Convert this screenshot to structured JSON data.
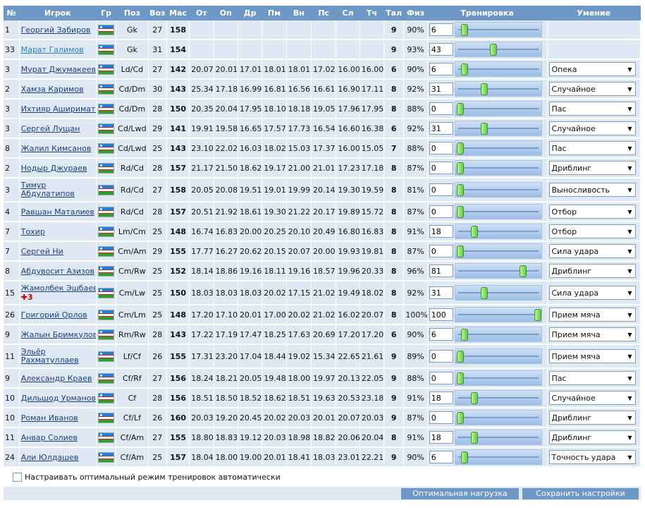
{
  "headers": {
    "num": "№",
    "player": "Игрок",
    "nation": "Гр",
    "pos": "Поз",
    "age": "Воз",
    "mastery": "Мас",
    "s1": "От",
    "s2": "Оп",
    "s3": "Др",
    "s4": "Пм",
    "s5": "Вн",
    "s6": "Пс",
    "s7": "Сл",
    "s8": "Тч",
    "talent": "Тал",
    "fitness": "Физ",
    "training": "Тренировка",
    "skill": "Умение"
  },
  "players": [
    {
      "num": "1",
      "name": "Георгий Забиров",
      "pos": "Gk",
      "age": "27",
      "mas": "158",
      "stats": [
        "",
        "",
        "",
        "",
        "",
        "",
        "",
        ""
      ],
      "tal": "9",
      "fiz": "90%",
      "train": "6",
      "skill": ""
    },
    {
      "num": "33",
      "name": "Марат Галимов",
      "pos": "Gk",
      "age": "31",
      "mas": "154",
      "stats": [
        "",
        "",
        "",
        "",
        "",
        "",
        "",
        ""
      ],
      "tal": "9",
      "fiz": "93%",
      "train": "43",
      "skill": ""
    },
    {
      "num": "3",
      "name": "Мурат Джумакеев",
      "pos": "Ld/Cd",
      "age": "27",
      "mas": "142",
      "stats": [
        "20.07",
        "20.01",
        "17.01",
        "18.01",
        "18.01",
        "17.02",
        "16.00",
        "16.00"
      ],
      "tal": "6",
      "fiz": "90%",
      "train": "6",
      "skill": "Опека"
    },
    {
      "num": "2",
      "name": "Хамза Каримов",
      "pos": "Cd/Dm",
      "age": "30",
      "mas": "143",
      "stats": [
        "25.34",
        "17.18",
        "16.99",
        "16.81",
        "16.56",
        "16.61",
        "16.90",
        "17.11"
      ],
      "tal": "8",
      "fiz": "92%",
      "train": "31",
      "skill": "Случайное"
    },
    {
      "num": "3",
      "name": "Ихтияр Ашириматов",
      "pos": "Cd/Dm",
      "age": "28",
      "mas": "150",
      "stats": [
        "20.35",
        "20.04",
        "17.95",
        "18.10",
        "18.18",
        "19.05",
        "17.96",
        "17.95"
      ],
      "tal": "8",
      "fiz": "88%",
      "train": "0",
      "skill": "Пас"
    },
    {
      "num": "3",
      "name": "Сергей Лущан",
      "pos": "Cd/Lwd",
      "age": "29",
      "mas": "141",
      "stats": [
        "19.91",
        "19.58",
        "16.65",
        "17.57",
        "17.73",
        "16.54",
        "16.60",
        "16.38"
      ],
      "tal": "6",
      "fiz": "92%",
      "train": "31",
      "skill": "Случайное"
    },
    {
      "num": "8",
      "name": "Жалил Кимсанов",
      "pos": "Cd/Lwd",
      "age": "25",
      "mas": "143",
      "stats": [
        "23.10",
        "22.02",
        "16.03",
        "18.02",
        "15.03",
        "17.37",
        "16.00",
        "15.05"
      ],
      "tal": "7",
      "fiz": "88%",
      "train": "0",
      "skill": "Пас"
    },
    {
      "num": "2",
      "name": "Нодыр Джураев",
      "pos": "Rd/Cd",
      "age": "28",
      "mas": "157",
      "stats": [
        "21.17",
        "21.50",
        "18.62",
        "19.17",
        "21.00",
        "21.01",
        "17.23",
        "17.18"
      ],
      "tal": "8",
      "fiz": "87%",
      "train": "0",
      "skill": "Дриблинг"
    },
    {
      "num": "3",
      "name": "Тимур Абдулатипов",
      "pos": "Rd/Cd",
      "age": "27",
      "mas": "158",
      "stats": [
        "20.05",
        "20.08",
        "19.51",
        "19.01",
        "19.99",
        "20.14",
        "19.30",
        "19.59"
      ],
      "tal": "8",
      "fiz": "81%",
      "train": "0",
      "skill": "Выносливость",
      "tall": true
    },
    {
      "num": "4",
      "name": "Равшан Маталиев",
      "pos": "Rd/Cd",
      "age": "28",
      "mas": "157",
      "stats": [
        "20.51",
        "21.92",
        "18.61",
        "19.30",
        "21.22",
        "20.17",
        "19.89",
        "15.72"
      ],
      "tal": "8",
      "fiz": "87%",
      "train": "0",
      "skill": "Отбор"
    },
    {
      "num": "7",
      "name": "Тохир",
      "pos": "Lm/Cm",
      "age": "25",
      "mas": "148",
      "stats": [
        "16.74",
        "16.83",
        "20.00",
        "20.25",
        "20.10",
        "20.49",
        "16.80",
        "16.83"
      ],
      "tal": "8",
      "fiz": "91%",
      "train": "18",
      "skill": "Отбор"
    },
    {
      "num": "7",
      "name": "Сергей Ни",
      "pos": "Cm/Am",
      "age": "29",
      "mas": "155",
      "stats": [
        "17.77",
        "16.27",
        "20.62",
        "20.15",
        "20.07",
        "20.00",
        "19.93",
        "19.81"
      ],
      "tal": "8",
      "fiz": "87%",
      "train": "0",
      "skill": "Сила удара"
    },
    {
      "num": "8",
      "name": "Абдувосит Азизов",
      "pos": "Cm/Rw",
      "age": "25",
      "mas": "152",
      "stats": [
        "18.14",
        "18.86",
        "19.16",
        "18.11",
        "19.16",
        "18.57",
        "19.96",
        "20.33"
      ],
      "tal": "8",
      "fiz": "96%",
      "train": "81",
      "skill": "Дриблинг"
    },
    {
      "num": "15",
      "name": "Жамолбек Эшбаев",
      "pos": "Cm/Lw",
      "age": "25",
      "mas": "150",
      "stats": [
        "18.03",
        "18.03",
        "18.03",
        "20.02",
        "17.15",
        "21.02",
        "19.49",
        "18.02"
      ],
      "tal": "8",
      "fiz": "92%",
      "train": "31",
      "skill": "Сила удара",
      "injury": "3",
      "tall": true
    },
    {
      "num": "26",
      "name": "Григорий Орлов",
      "pos": "Cm/Lm",
      "age": "25",
      "mas": "148",
      "stats": [
        "17.20",
        "17.10",
        "20.01",
        "17.00",
        "20.02",
        "21.02",
        "16.02",
        "20.07"
      ],
      "tal": "8",
      "fiz": "100%",
      "train": "100",
      "skill": "Прием мяча"
    },
    {
      "num": "9",
      "name": "Жалын Бримкулов",
      "pos": "Rm/Rw",
      "age": "28",
      "mas": "143",
      "stats": [
        "17.22",
        "17.19",
        "17.47",
        "18.25",
        "17.63",
        "20.69",
        "17.20",
        "17.20"
      ],
      "tal": "6",
      "fiz": "90%",
      "train": "6",
      "skill": "Прием мяча"
    },
    {
      "num": "11",
      "name": "Эльёр Рахматуллаев",
      "pos": "Lf/Cf",
      "age": "26",
      "mas": "155",
      "stats": [
        "17.31",
        "23.20",
        "17.04",
        "18.44",
        "19.02",
        "15.34",
        "22.65",
        "21.61"
      ],
      "tal": "9",
      "fiz": "89%",
      "train": "0",
      "skill": "Прием мяча",
      "tall": true
    },
    {
      "num": "9",
      "name": "Александр Краев",
      "pos": "Cf/Rf",
      "age": "27",
      "mas": "156",
      "stats": [
        "18.24",
        "18.21",
        "20.05",
        "19.48",
        "18.00",
        "19.97",
        "20.13",
        "22.05"
      ],
      "tal": "9",
      "fiz": "88%",
      "train": "0",
      "skill": "Пас"
    },
    {
      "num": "10",
      "name": "Дильшод Урманов",
      "pos": "Cf",
      "age": "28",
      "mas": "156",
      "stats": [
        "18.51",
        "18.50",
        "18.52",
        "18.62",
        "18.51",
        "19.63",
        "20.53",
        "23.18"
      ],
      "tal": "9",
      "fiz": "91%",
      "train": "18",
      "skill": "Случайное"
    },
    {
      "num": "10",
      "name": "Роман Иванов",
      "pos": "Cf/Lf",
      "age": "26",
      "mas": "160",
      "stats": [
        "20.03",
        "19.20",
        "20.45",
        "20.02",
        "20.03",
        "20.01",
        "20.07",
        "20.03"
      ],
      "tal": "9",
      "fiz": "87%",
      "train": "0",
      "skill": "Дриблинг"
    },
    {
      "num": "11",
      "name": "Анвар Солиев",
      "pos": "Cf/Am",
      "age": "27",
      "mas": "155",
      "stats": [
        "18.80",
        "18.83",
        "19.12",
        "20.03",
        "18.98",
        "18.82",
        "20.06",
        "20.04"
      ],
      "tal": "8",
      "fiz": "91%",
      "train": "18",
      "skill": "Дриблинг"
    },
    {
      "num": "24",
      "name": "Али Юлдашев",
      "pos": "Cf/Am",
      "age": "25",
      "mas": "157",
      "stats": [
        "18.04",
        "18.00",
        "19.00",
        "20.01",
        "18.41",
        "18.03",
        "23.01",
        "22.21"
      ],
      "tal": "9",
      "fiz": "90%",
      "train": "6",
      "skill": "Точность удара"
    }
  ],
  "footer": {
    "auto_label": "Настраивать оптимальный режим тренировок автоматически",
    "optimal_button": "Оптимальная нагрузка",
    "save_button": "Сохранить настройки"
  },
  "colors": {
    "header": "#6d98c5",
    "row": "#dfe9f4",
    "link": "#1f3f7f"
  },
  "icons": {
    "nation": "uzbekistan-flag-icon",
    "injury": "red-cross-icon",
    "dropdown": "chevron-down-icon",
    "slider": "slider-handle-icon"
  }
}
